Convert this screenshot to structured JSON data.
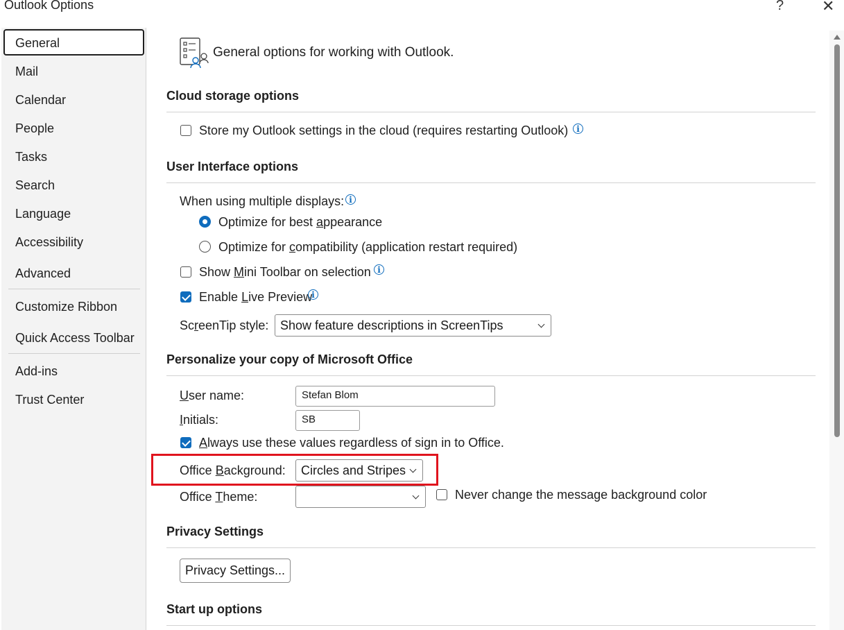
{
  "window": {
    "title": "Outlook Options",
    "help": "?",
    "close": "✕"
  },
  "sidebar": {
    "items": [
      {
        "label": "General"
      },
      {
        "label": "Mail"
      },
      {
        "label": "Calendar"
      },
      {
        "label": "People"
      },
      {
        "label": "Tasks"
      },
      {
        "label": "Search"
      },
      {
        "label": "Language"
      },
      {
        "label": "Accessibility"
      },
      {
        "label": "Advanced"
      },
      {
        "label": "Customize Ribbon"
      },
      {
        "label": "Quick Access Toolbar"
      },
      {
        "label": "Add-ins"
      },
      {
        "label": "Trust Center"
      }
    ]
  },
  "main": {
    "header": "General options for working with Outlook.",
    "cloud": {
      "heading": "Cloud storage options",
      "store_label": "Store my Outlook settings in the cloud (requires restarting Outlook)"
    },
    "ui": {
      "heading": "User Interface options",
      "multi_display": "When using multiple displays:",
      "opt_best_pre": "Optimize for best ",
      "opt_best_u": "a",
      "opt_best_post": "ppearance",
      "opt_compat_pre": "Optimize for ",
      "opt_compat_u": "c",
      "opt_compat_post": "ompatibility (application restart required)",
      "mini_pre": "Show ",
      "mini_u": "M",
      "mini_post": "ini Toolbar on selection",
      "live_pre": "Enable ",
      "live_u": "L",
      "live_post": "ive Preview",
      "screentip_pre": "Sc",
      "screentip_u": "r",
      "screentip_post": "eenTip style:",
      "screentip_value": "Show feature descriptions in ScreenTips"
    },
    "personalize": {
      "heading": "Personalize your copy of Microsoft Office",
      "username_u": "U",
      "username_post": "ser name:",
      "username_value": "Stefan Blom",
      "initials_u": "I",
      "initials_post": "nitials:",
      "initials_value": "SB",
      "always_u": "A",
      "always_post": "lways use these values regardless of sign in to Office.",
      "bg_pre": "Office ",
      "bg_u": "B",
      "bg_post": "ackground:",
      "bg_value": "Circles and Stripes",
      "theme_pre": "Office ",
      "theme_u": "T",
      "theme_post": "heme:",
      "theme_value": "",
      "never_change": "Never change the message background color"
    },
    "privacy": {
      "heading": "Privacy Settings",
      "button": "Privacy Settings..."
    },
    "startup": {
      "heading": "Start up options"
    }
  },
  "colors": {
    "accent": "#0f6cbd",
    "highlight": "#e0141e"
  }
}
